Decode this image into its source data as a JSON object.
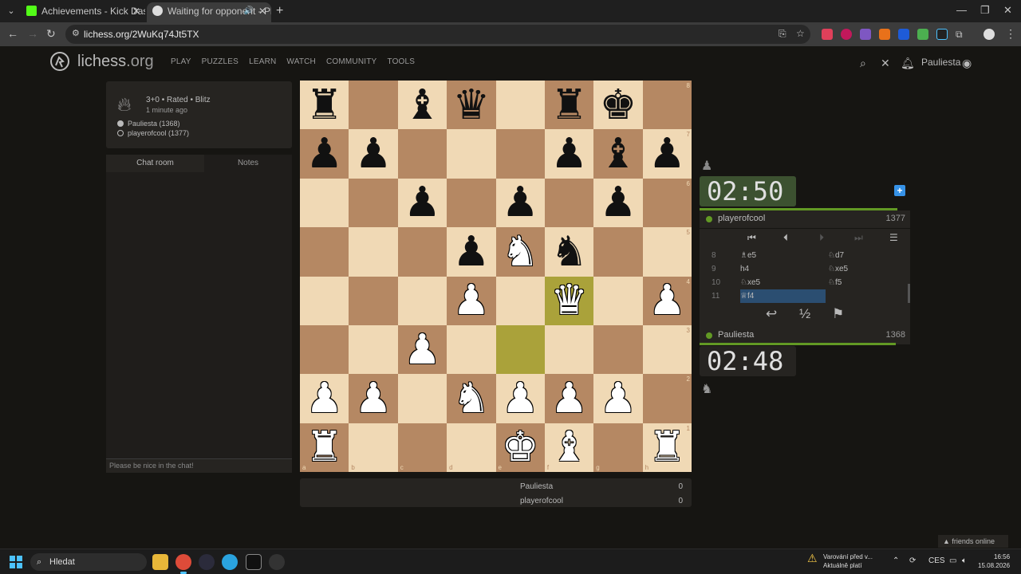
{
  "browser": {
    "tabs": [
      {
        "title": "Achievements - Kick Dashboard",
        "active": false
      },
      {
        "title": "Waiting for opponent - Pla",
        "active": true
      }
    ],
    "url": "lichess.org/2WuKq74Jt5TX"
  },
  "site": {
    "logo": "lichess",
    "logo_suffix": ".org",
    "nav": [
      "PLAY",
      "PUZZLES",
      "LEARN",
      "WATCH",
      "COMMUNITY",
      "TOOLS"
    ],
    "username": "Pauliesta"
  },
  "game": {
    "setup": "3+0 • Rated • Blitz",
    "time_ago": "1 minute ago",
    "players": [
      "Pauliesta (1368)",
      "playerofcool (1377)"
    ]
  },
  "chat": {
    "tab_chat": "Chat room",
    "tab_notes": "Notes",
    "placeholder": "Please be nice in the chat!"
  },
  "board": {
    "rows": [
      [
        "bR",
        "",
        "bB",
        "bQ",
        "",
        "bR",
        "bK",
        ""
      ],
      [
        "bP",
        "bP",
        "",
        "",
        "",
        "bP",
        "bB",
        "bP"
      ],
      [
        "",
        "",
        "bP",
        "",
        "bP",
        "",
        "bP",
        ""
      ],
      [
        "",
        "",
        "",
        "bP",
        "wN",
        "bN",
        "",
        ""
      ],
      [
        "",
        "",
        "",
        "wP",
        "",
        "wQ",
        "",
        "wP"
      ],
      [
        "",
        "",
        "wP",
        "",
        "",
        "",
        "",
        ""
      ],
      [
        "wP",
        "wP",
        "",
        "wN",
        "wP",
        "wP",
        "wP",
        ""
      ],
      [
        "wR",
        "",
        "",
        "",
        "wK",
        "wB",
        "",
        "wR"
      ]
    ],
    "last_move": [
      "e3",
      "f4"
    ],
    "files": [
      "a",
      "b",
      "c",
      "d",
      "e",
      "f",
      "g",
      "h"
    ],
    "ranks": [
      "8",
      "7",
      "6",
      "5",
      "4",
      "3",
      "2",
      "1"
    ]
  },
  "score": [
    {
      "name": "Pauliesta",
      "value": "0"
    },
    {
      "name": "playerofcool",
      "value": "0"
    }
  ],
  "opponent": {
    "clock": "02:50",
    "name": "playerofcool",
    "rating": "1377",
    "time_fraction": 0.94
  },
  "me": {
    "clock": "02:48",
    "name": "Pauliesta",
    "rating": "1368",
    "time_fraction": 0.93
  },
  "moves": [
    {
      "num": "8",
      "white": "♗e5",
      "black": "♘d7"
    },
    {
      "num": "9",
      "white": "h4",
      "black": "♘xe5"
    },
    {
      "num": "10",
      "white": "♘xe5",
      "black": "♘f5"
    },
    {
      "num": "11",
      "white": "♕f4",
      "black": ""
    }
  ],
  "controls": {
    "takeback": "↩",
    "draw": "½",
    "resign": "⚑"
  },
  "friends": "friends online",
  "taskbar": {
    "search": "Hledat",
    "notification_line1": "Varování před v...",
    "notification_line2": "Aktuálně platí",
    "lang": "CES",
    "time": "16:56",
    "date": "15.08.2026"
  },
  "colors": {
    "accent": "#629924",
    "last_move": "#aaa23a",
    "light_sq": "#f0d9b5",
    "dark_sq": "#b58863"
  }
}
